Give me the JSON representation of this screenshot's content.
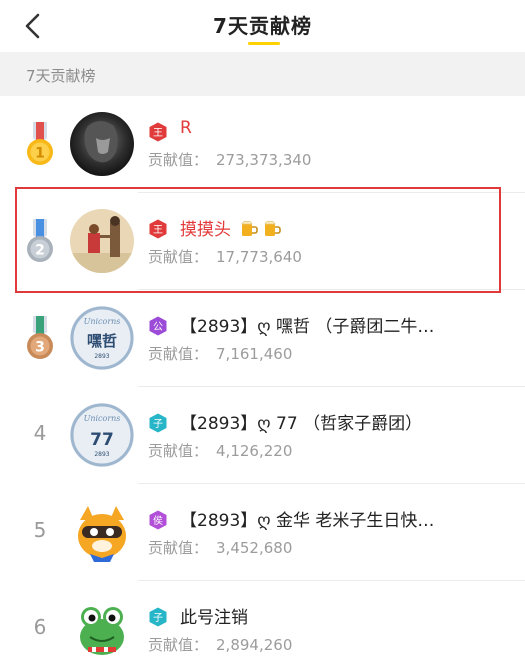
{
  "header": {
    "title": "7天贡献榜"
  },
  "section": {
    "label": "7天贡献榜"
  },
  "contrib_label": "贡献值：",
  "colors": {
    "accent": "#ffd100",
    "highlight": "#e0393c",
    "name_red": "#e33b3b"
  },
  "rows": [
    {
      "rank": "1",
      "medal": "gold",
      "badge": "王",
      "badge_color": "#e03a3a",
      "name": "R",
      "name_red": true,
      "extra": "",
      "value": "273,373,340"
    },
    {
      "rank": "2",
      "medal": "silver",
      "badge": "王",
      "badge_color": "#e03a3a",
      "name": "摸摸头",
      "name_red": true,
      "extra": "beer-x2",
      "value": "17,773,640"
    },
    {
      "rank": "3",
      "medal": "bronze",
      "badge": "公",
      "badge_color": "#9b4bd8",
      "name": "【2893】ღ 嘿哲 （子爵团二牛…",
      "name_red": false,
      "extra": "",
      "value": "7,161,460"
    },
    {
      "rank": "4",
      "medal": "",
      "badge": "子",
      "badge_color": "#27b5c8",
      "name": "【2893】ღ 77 （哲家子爵团）",
      "name_red": false,
      "extra": "",
      "value": "4,126,220"
    },
    {
      "rank": "5",
      "medal": "",
      "badge": "侯",
      "badge_color": "#b24fd8",
      "name": "【2893】ღ 金华 老米子生日快…",
      "name_red": false,
      "extra": "",
      "value": "3,452,680"
    },
    {
      "rank": "6",
      "medal": "",
      "badge": "子",
      "badge_color": "#27b5c8",
      "name": "此号注销",
      "name_red": false,
      "extra": "",
      "value": "2,894,260"
    }
  ]
}
